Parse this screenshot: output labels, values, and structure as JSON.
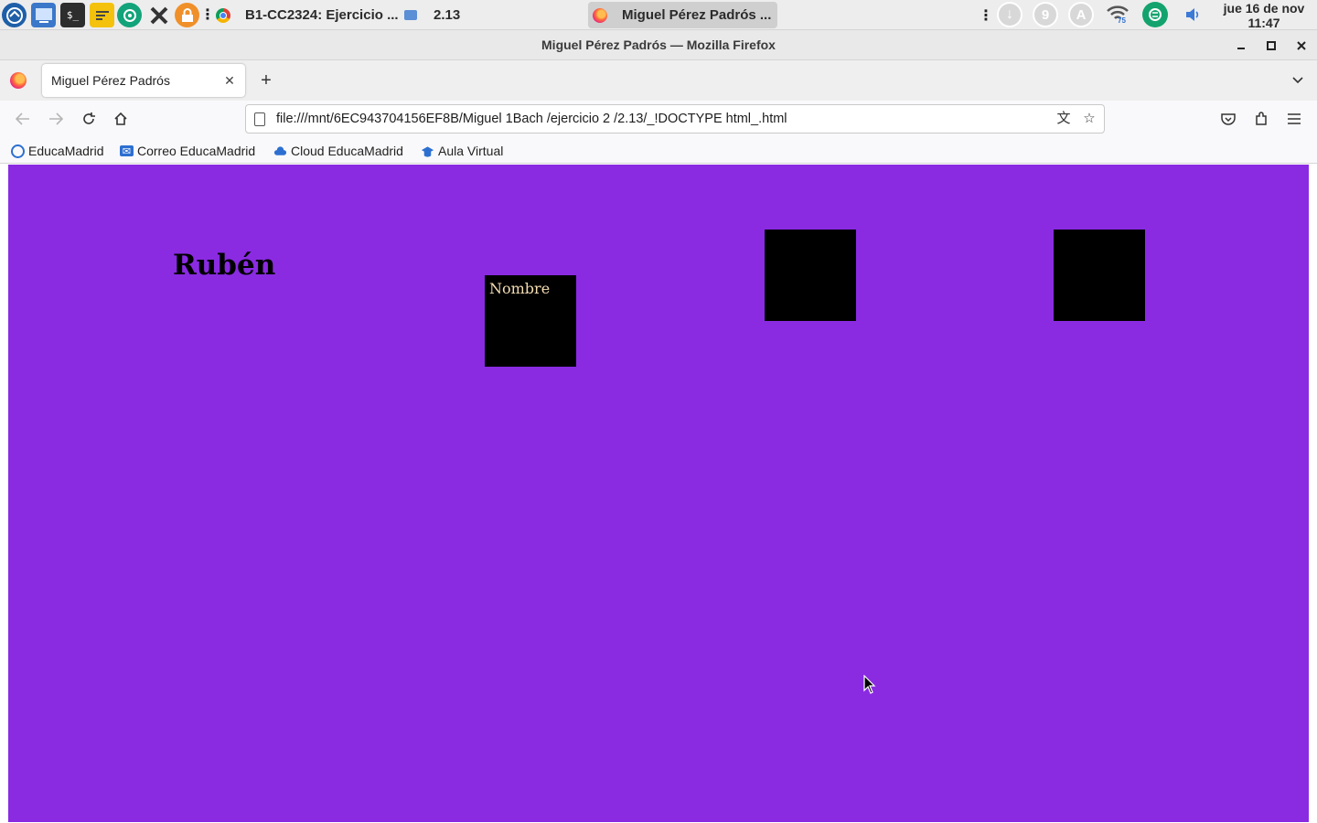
{
  "panel": {
    "taskbar_items": [
      {
        "label": "B1-CC2324: Ejercicio ...",
        "icon": "chrome-icon"
      },
      {
        "label": "2.13",
        "icon": "folder-icon"
      },
      {
        "label": "Miguel Pérez Padrós ...",
        "icon": "firefox-icon",
        "active": true
      }
    ],
    "tray_badge": "9",
    "tray_letter": "A",
    "wifi_badge": "75",
    "clock_date": "jue 16 de nov",
    "clock_time": "11:47"
  },
  "window": {
    "title": "Miguel Pérez Padrós — Mozilla Firefox"
  },
  "tabs": [
    {
      "label": "Miguel Pérez Padrós",
      "active": true
    }
  ],
  "navbar": {
    "url": "file:///mnt/6EC943704156EF8B/Miguel 1Bach /ejercicio 2 /2.13/_!DOCTYPE html_.html"
  },
  "bookmarks": [
    {
      "label": "EducaMadrid",
      "icon": "educamadrid-icon"
    },
    {
      "label": "Correo EducaMadrid",
      "icon": "mail-icon"
    },
    {
      "label": "Cloud EducaMadrid",
      "icon": "cloud-icon"
    },
    {
      "label": "Aula Virtual",
      "icon": "graduation-cap-icon"
    }
  ],
  "page": {
    "background": "#8a2be2",
    "heading": "Rubén",
    "box_text": "Nombre",
    "box_color": "#000000",
    "box_text_color": "#f5deb3"
  }
}
